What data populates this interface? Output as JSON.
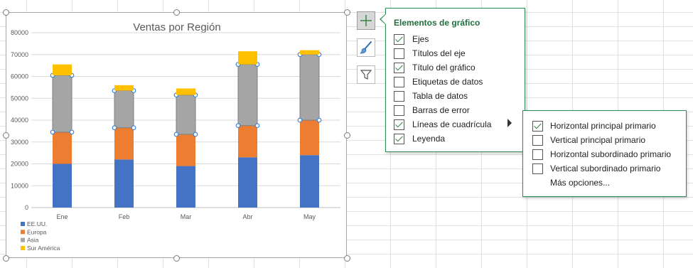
{
  "chart_data": {
    "type": "bar",
    "stacked": true,
    "title": "Ventas por Región",
    "categories": [
      "Ene",
      "Feb",
      "Mar",
      "Abr",
      "May"
    ],
    "series": [
      {
        "name": "EE.UU.",
        "color": "#4472c4",
        "values": [
          20000,
          22000,
          19000,
          23000,
          24000
        ]
      },
      {
        "name": "Europa",
        "color": "#ed7d31",
        "values": [
          14500,
          14500,
          14500,
          14500,
          16000
        ]
      },
      {
        "name": "Asia",
        "color": "#a5a5a5",
        "values": [
          26000,
          17000,
          18000,
          28000,
          30000
        ]
      },
      {
        "name": "Sur América",
        "color": "#ffc000",
        "values": [
          5000,
          2500,
          3000,
          6000,
          2000
        ]
      }
    ],
    "yticks": [
      "0",
      "10000",
      "20000",
      "30000",
      "40000",
      "50000",
      "60000",
      "70000",
      "80000"
    ],
    "ylim": [
      0,
      80000
    ],
    "grid": true,
    "legend_position": "bottom-left",
    "selected_series": "Asia"
  },
  "side_buttons": {
    "elements": "plus-icon",
    "styles": "brush-icon",
    "filters": "funnel-icon"
  },
  "elements_panel": {
    "title": "Elementos de gráfico",
    "options": [
      {
        "label": "Ejes",
        "checked": true
      },
      {
        "label": "Títulos del eje",
        "checked": false
      },
      {
        "label": "Título del gráfico",
        "checked": true
      },
      {
        "label": "Etiquetas de datos",
        "checked": false
      },
      {
        "label": "Tabla de datos",
        "checked": false
      },
      {
        "label": "Barras de error",
        "checked": false
      },
      {
        "label": "Líneas de cuadrícula",
        "checked": true,
        "has_submenu": true
      },
      {
        "label": "Leyenda",
        "checked": true
      }
    ]
  },
  "gridlines_submenu": {
    "options": [
      {
        "label": "Horizontal principal primario",
        "checked": true
      },
      {
        "label": "Vertical principal primario",
        "checked": false
      },
      {
        "label": "Horizontal subordinado primario",
        "checked": false
      },
      {
        "label": "Vertical subordinado primario",
        "checked": false
      }
    ],
    "more_options": "Más opciones..."
  }
}
